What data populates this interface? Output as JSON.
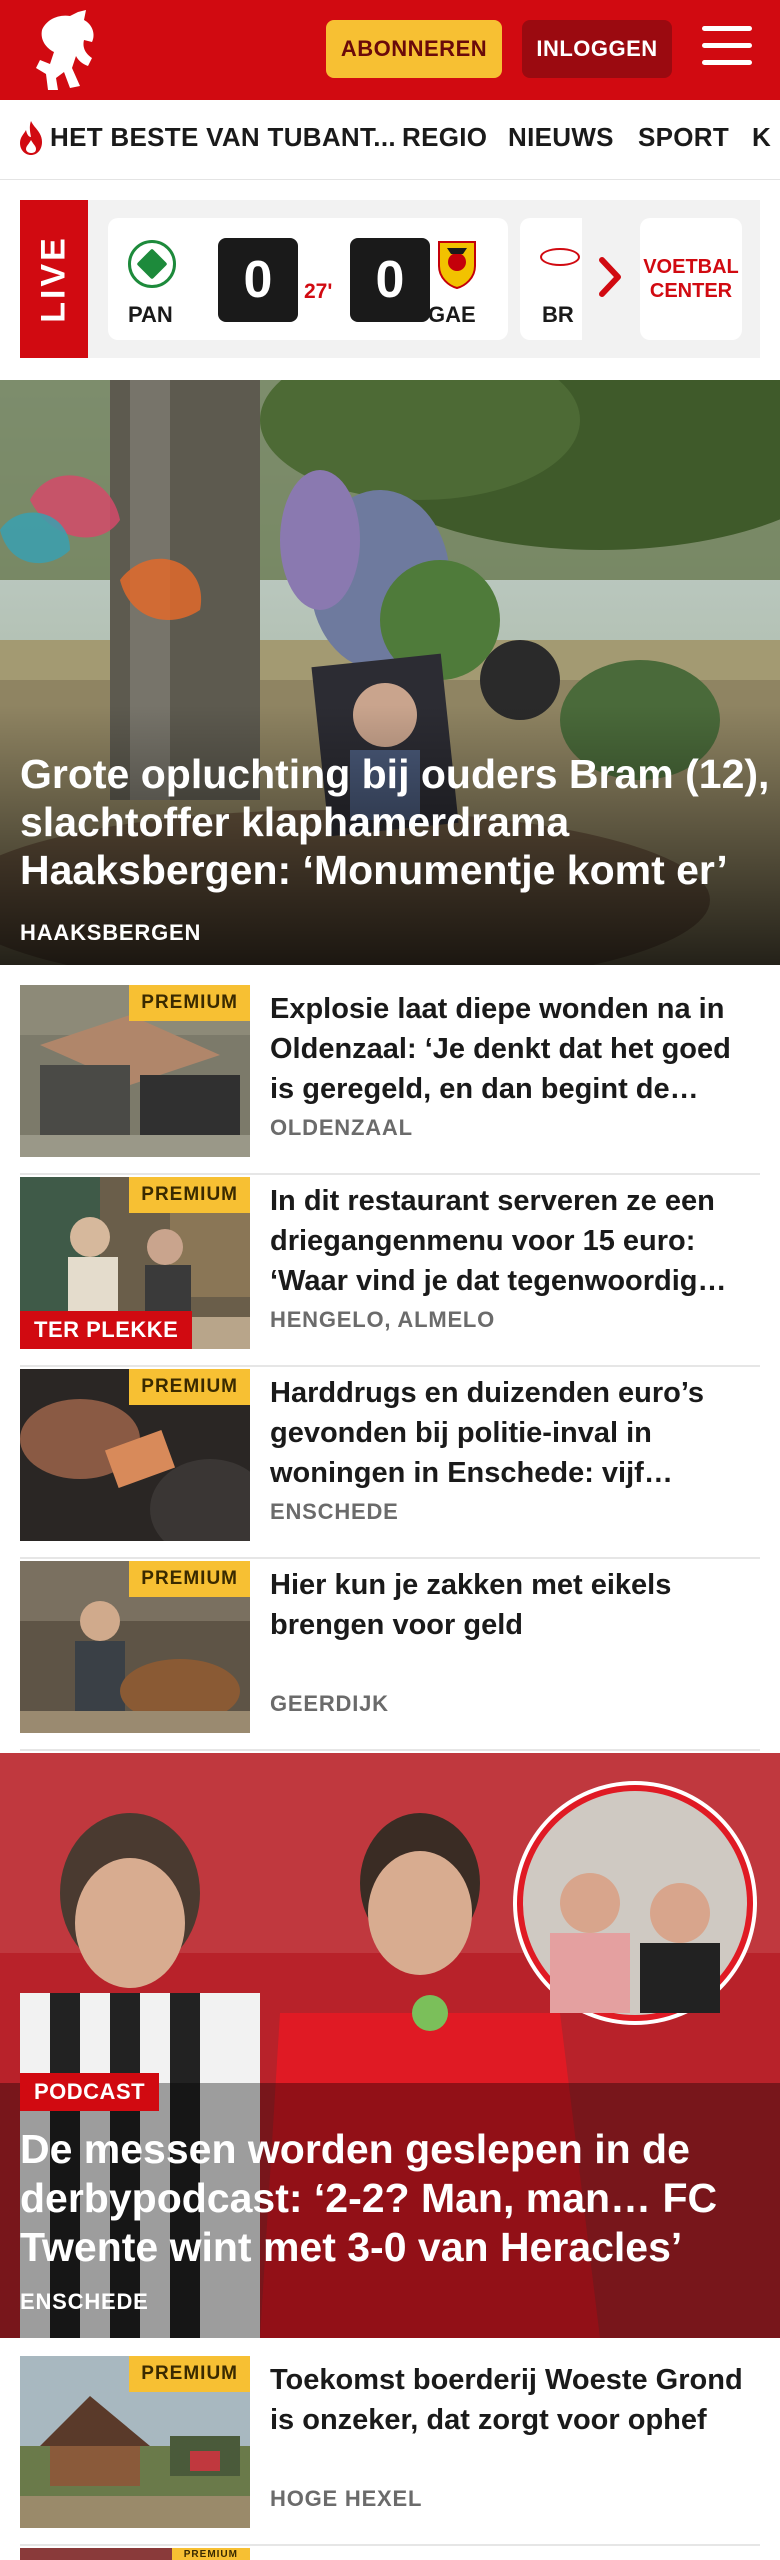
{
  "header": {
    "subscribe_label": "ABONNEREN",
    "login_label": "INLOGGEN"
  },
  "nav": {
    "items": [
      "HET BESTE VAN TUBANT...",
      "REGIO",
      "NIEUWS",
      "SPORT",
      "K"
    ]
  },
  "live": {
    "label": "LIVE",
    "match": {
      "home": "PAN",
      "home_score": "0",
      "minute": "27'",
      "away_score": "0",
      "away": "GAE"
    },
    "next_team": "BR",
    "voetbal_center": "VOETBAL CENTER"
  },
  "hero": {
    "title": "Grote opluchting bij ouders Bram (12), slachtoffer klaphamerdrama Haaksbergen: ‘Monumentje komt er’",
    "location": "HAAKSBERGEN"
  },
  "articles": [
    {
      "badge": "PREMIUM",
      "title": "Explosie laat diepe wonden na in Oldenzaal: ‘Je denkt dat het goed is geregeld, en dan begint de…",
      "location": "OLDENZAAL"
    },
    {
      "badge": "PREMIUM",
      "tag": "TER PLEKKE",
      "title": "In dit restaurant serveren ze een driegangenmenu voor 15 euro: ‘Waar vind je dat tegenwoordig…",
      "location": "HENGELO, ALMELO"
    },
    {
      "badge": "PREMIUM",
      "title": "Harddrugs en duizenden euro’s gevonden bij politie-inval in woningen in Enschede: vijf…",
      "location": "ENSCHEDE"
    },
    {
      "badge": "PREMIUM",
      "title": "Hier kun je zakken met eikels brengen voor geld",
      "location": "GEERDIJK"
    }
  ],
  "podcast": {
    "tag": "PODCAST",
    "title": "De messen worden geslepen in de derbypodcast: ‘2-2? Man, man… FC Twente wint met 3-0 van Heracles’",
    "location": "ENSCHEDE"
  },
  "articles_bottom": [
    {
      "badge": "PREMIUM",
      "title": "Toekomst boerderij Woeste Grond is onzeker, dat zorgt voor ophef",
      "location": "HOGE HEXEL"
    },
    {
      "badge": "PREMIUM"
    }
  ],
  "colors": {
    "brand_red": "#d10a11",
    "premium_yellow": "#f7c033",
    "login_dark_red": "#9b0a10"
  },
  "icons": [
    "horse-logo-icon",
    "hamburger-menu-icon",
    "flame-icon",
    "chevron-right-icon"
  ]
}
